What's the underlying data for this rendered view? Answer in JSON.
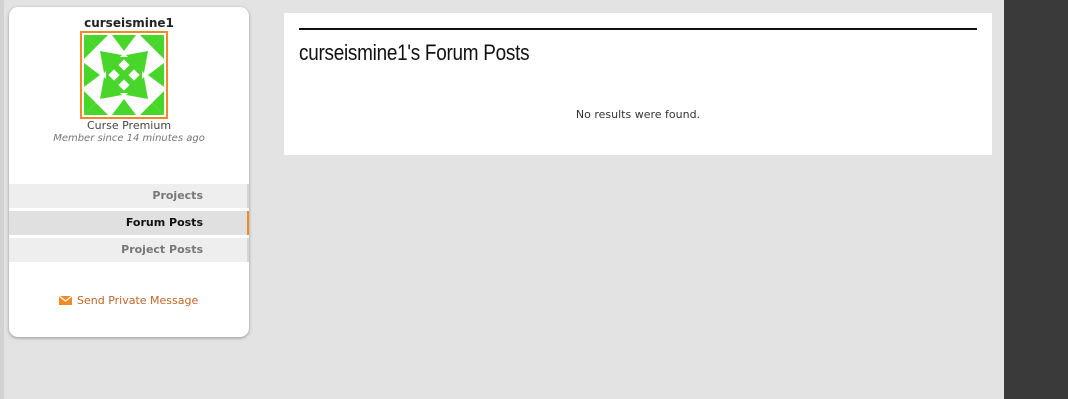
{
  "profile": {
    "username": "curseismine1",
    "rank": "Curse Premium",
    "member_since": "Member since 14 minutes ago",
    "avatar_colors": {
      "accent": "#48d62a",
      "background": "#ffffff",
      "border": "#f08a24"
    }
  },
  "nav": {
    "items": [
      {
        "label": "Projects",
        "active": false
      },
      {
        "label": "Forum Posts",
        "active": true
      },
      {
        "label": "Project Posts",
        "active": false
      }
    ]
  },
  "actions": {
    "send_message_label": "Send Private Message",
    "send_message_icon": "envelope-icon"
  },
  "main": {
    "title": "curseismine1's Forum Posts",
    "empty_message": "No results were found."
  },
  "colors": {
    "accent": "#f08a24",
    "link": "#c0652a",
    "page_background": "#e3e3e3",
    "sidebar_dark": "#3a3a3a"
  }
}
